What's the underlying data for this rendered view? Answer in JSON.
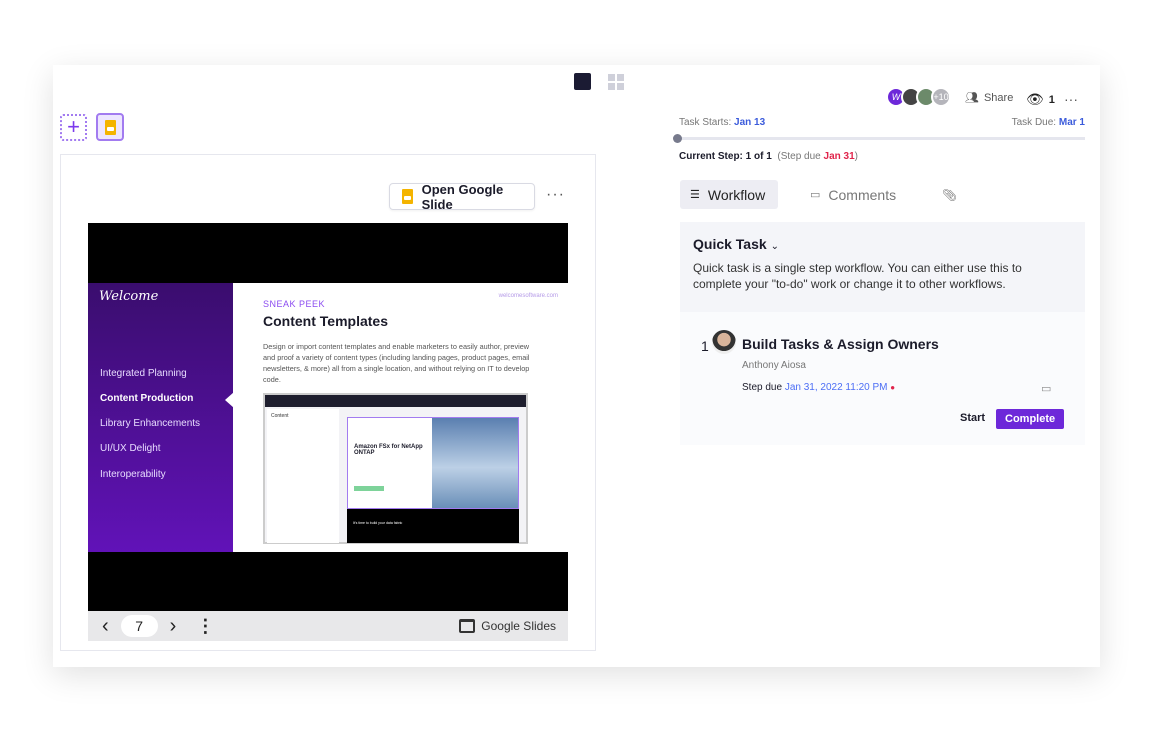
{
  "view_toggle": {
    "single": "single-view-icon",
    "grid": "grid-view-icon"
  },
  "left": {
    "add_label": "+",
    "open_button": "Open Google Slide",
    "more": "···",
    "slide": {
      "welcome": "Welcome",
      "nav": [
        "Integrated Planning",
        "Content Production",
        "Library Enhancements",
        "UI/UX Delight",
        "Interoperability"
      ],
      "active_index": 1,
      "url": "welcomesoftware.com",
      "eyebrow": "SNEAK PEEK",
      "title": "Content Templates",
      "description": "Design or import content templates and enable marketers to easily author, preview and proof a variety of content types (including landing pages, product pages, email newsletters, & more) all from a single location, and without relying on IT to develop code.",
      "inner": {
        "panel_title": "Content",
        "hero_title": "Amazon FSx for NetApp ONTAP",
        "footer": "It's time to build your data fabric"
      }
    },
    "toolbar": {
      "prev": "‹",
      "page": "7",
      "next": "›",
      "menu": "⋮",
      "brand": "Google Slides"
    }
  },
  "right": {
    "avatar_more": "+10",
    "avatar_initial": "W",
    "share": "Share",
    "viewers": "1",
    "more": "···",
    "task_starts_label": "Task Starts:",
    "task_starts": "Jan 13",
    "task_due_label": "Task Due:",
    "task_due": "Mar 1",
    "progress": 0,
    "current_step": "Current Step: 1 of 1",
    "step_due_prefix": "(Step due ",
    "step_due": "Jan 31",
    "step_due_suffix": ")",
    "tabs": [
      {
        "label": "Workflow"
      },
      {
        "label": "Comments"
      }
    ],
    "workflow": {
      "title": "Quick Task",
      "description": "Quick task is a single step workflow. You can either use this to complete your \"to-do\" work or change it to other workflows.",
      "step": {
        "number": "1",
        "title": "Build Tasks & Assign Owners",
        "owner": "Anthony Aiosa",
        "due_label": "Step due",
        "due": "Jan 31, 2022 11:20 PM",
        "start": "Start",
        "complete": "Complete"
      }
    }
  },
  "colors": {
    "accent": "#6d28d9",
    "link": "#3b5bdb",
    "overdue": "#e0244b"
  }
}
